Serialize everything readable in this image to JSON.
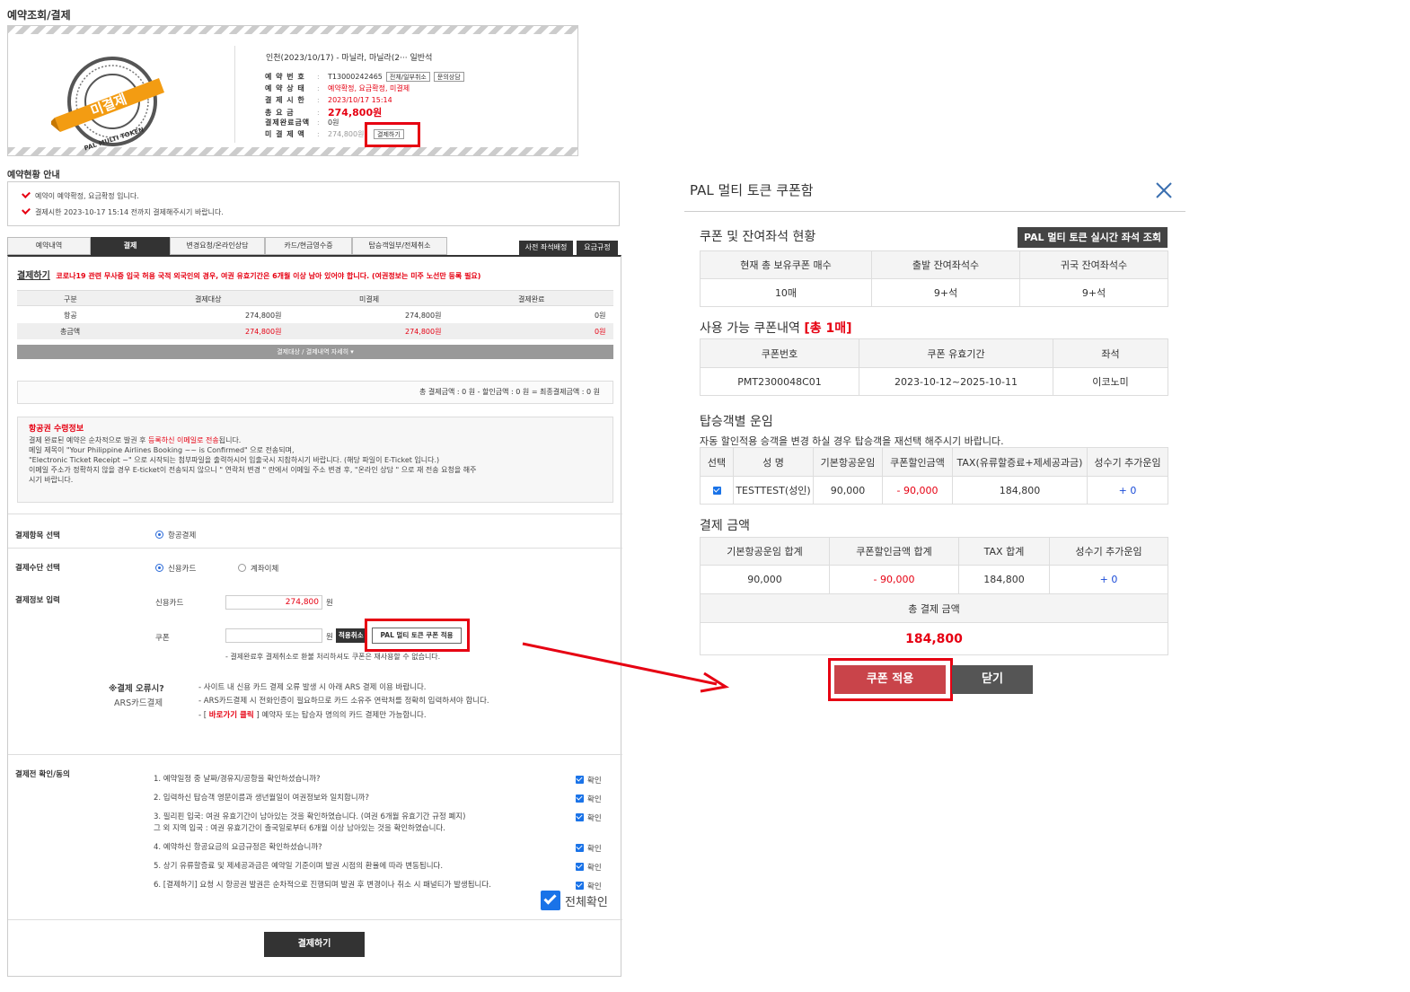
{
  "page": {
    "title": "예약조회/결제"
  },
  "summary": {
    "stamp_text": "미결제",
    "stamp_ring_text": "PAL MULTI TOKEN",
    "route": "인천(2023/10/17) - 마닐라, 마닐라(2··· 일반석",
    "rows": [
      {
        "label": "예 약 번 호",
        "value": "T13000242465"
      },
      {
        "label": "예 약 상 태",
        "value": "예약확정, 요금확정, 미결제"
      },
      {
        "label": "결 제 시 한",
        "value": "2023/10/17 15:14"
      },
      {
        "label": "총 요 금",
        "value": "274,800원"
      },
      {
        "label": "결제완료금액",
        "value": "0원"
      },
      {
        "label": "미 결 제 액",
        "value": "274,800원"
      }
    ],
    "btn_cancel": "전체/일부취소",
    "btn_consult": "문의상담",
    "btn_pay": "결제하기"
  },
  "notice": {
    "title": "예약현황 안내",
    "lines": [
      "예약이 예약확정, 요금확정 입니다.",
      "결제시한 2023-10-17 15:14 전까지 결제해주시기 바랍니다."
    ]
  },
  "tabs": [
    "예약내역",
    "결제",
    "변경요청/온라인상담",
    "카드/현금영수증",
    "탑승객일부/전체취소"
  ],
  "tabs_right": [
    "사전 좌석배정",
    "요금규정"
  ],
  "payment": {
    "heading": "결제하기",
    "covid_notice": "코로나19 관련 무사증 입국 허용 국적 외국인의 경우, 여권 유효기간은 6개월 이상 남아 있어야 합니다. (여권정보는 미주 노선만 등록 필요)",
    "headers": [
      "구분",
      "결제대상",
      "미결제",
      "결제완료"
    ],
    "rows": [
      [
        "항공",
        "274,800원",
        "274,800원",
        "0원"
      ],
      [
        "총금액",
        "274,800원",
        "274,800원",
        "0원"
      ]
    ],
    "detail_toggle": "결제대상 / 결제내역 자세히 ▾",
    "total_line": "총 결제금액 : 0 원 - 할인금액 : 0 원 = 최종결제금액 : 0 원"
  },
  "ticket_info": {
    "title": "항공권 수령정보",
    "line1a": "결제 완료된 예약은 순차적으로 발권 후 ",
    "line1b": "등록하신 이메일로 전송",
    "line1c": "됩니다.",
    "line2": "메일 제목이 \"Your Philippine Airlines Booking ~~ is Confirmed\" 으로 전송되며,",
    "line3": "\"Electronic Ticket Receipt ~\" 으로 시작되는 첨부파일을 출력하시어 입출국시 지참하시기 바랍니다. (해당 파일이 E-Ticket 입니다.)",
    "line4": "이메일 주소가 정확하지 않을 경우 E-ticket이 전송되지 않으니 \" 연락처 변경 \" 란에서 이메일 주소 변경 후, \"온라인 상담 \" 으로 재 전송 요청을 해주",
    "line5": "시기 바랍니다."
  },
  "form": {
    "item_label": "결제항목 선택",
    "item_option": "항공결제",
    "method_label": "결제수단 선택",
    "method_card": "신용카드",
    "method_transfer": "계좌이체",
    "info_label": "결제정보 입력",
    "card_label": "신용카드",
    "card_value": "274,800",
    "won": "원",
    "coupon_label": "쿠폰",
    "coupon_value": "",
    "coupon_cancel": "적용취소",
    "coupon_apply": "PAL 멀티 토큰 쿠폰 적용",
    "coupon_note": "- 결제완료후 결제취소로 환불 처리하셔도 쿠폰은 재사용할 수 없습니다.",
    "error_title": "※결제 오류시?",
    "ars_label": "ARS카드결제",
    "ars_line1": "- 사이트 내 신용 카드 결제 오류 발생 시 아래 ARS 결제 이용 바랍니다.",
    "ars_line2": "- ARS카드결제 시 전화인증이 필요하므로 카드 소유주 연락처를 정확히 입력하셔야 합니다.",
    "ars_line3a": "- [ ",
    "ars_link": "바로가기 클릭",
    "ars_line3b": " ] 예약자 또는 탑승자 명의의 카드 결제만 가능합니다."
  },
  "agree": {
    "label": "결제전 확인/동의",
    "items": [
      "1. 예약일정 중 날짜/경유지/공항을 확인하셨습니까?",
      "2. 입력하신 탑승객 영문이름과 생년월일이 여권정보와 일치합니까?",
      "3. 필리핀 입국: 여권 유효기간이 남아있는 것을 확인하였습니다. (여권 6개월 유효기간 규정 폐지)",
      "4. 예약하신 항공요금의 요금규정은 확인하셨습니까?",
      "5. 상기 유류할증료 및 제세공과금은 예약일 기준이며 발권 시점의 환율에 따라 변동됩니다.",
      "6. [결제하기] 요청 시 항공권 발권은 순차적으로 진행되며 발권 후 변경이나 취소 시 패널티가 발생됩니다."
    ],
    "item3_extra": "그 외 지역 입국 : 여권 유효기간이 출국일로부터 6개월 이상 남아있는 것을 확인하였습니다.",
    "check_label": "확인",
    "all_label": "전체확인",
    "pay_button": "결제하기"
  },
  "modal": {
    "title": "PAL 멀티 토큰 쿠폰함",
    "status_title": "쿠폰 및 잔여좌석 현황",
    "realtime_btn": "PAL 멀티 토큰 실시간 좌석 조회",
    "status_headers": [
      "현재 총 보유쿠폰 매수",
      "출발 잔여좌석수",
      "귀국 잔여좌석수"
    ],
    "status_values": [
      "10매",
      "9+석",
      "9+석"
    ],
    "coupons_title": "사용 가능 쿠폰내역",
    "coupons_count": "[총 1매]",
    "coupon_headers": [
      "쿠폰번호",
      "쿠폰 유효기간",
      "좌석"
    ],
    "coupon_row": [
      "PMT2300048C01",
      "2023-10-12~2025-10-11",
      "이코노미"
    ],
    "fare_title": "탑승객별 운임",
    "fare_note": "자동 할인적용 승객을 변경 하실 경우 탑승객을 재선택 해주시기 바랍니다.",
    "fare_headers": [
      "선택",
      "성 명",
      "기본항공운임",
      "쿠폰할인금액",
      "TAX(유류할증료+제세공과금)",
      "성수기 추가운임"
    ],
    "fare_row": [
      "TESTTEST(성인)",
      "90,000",
      "- 90,000",
      "184,800",
      "+ 0"
    ],
    "pay_title": "결제 금액",
    "pay_headers": [
      "기본항공운임 합계",
      "쿠폰할인금액 합계",
      "TAX 합계",
      "성수기 추가운임"
    ],
    "pay_row": [
      "90,000",
      "- 90,000",
      "184,800",
      "+ 0"
    ],
    "total_label": "총 결제 금액",
    "total_value": "184,800",
    "apply_btn": "쿠폰 적용",
    "close_btn": "닫기"
  }
}
